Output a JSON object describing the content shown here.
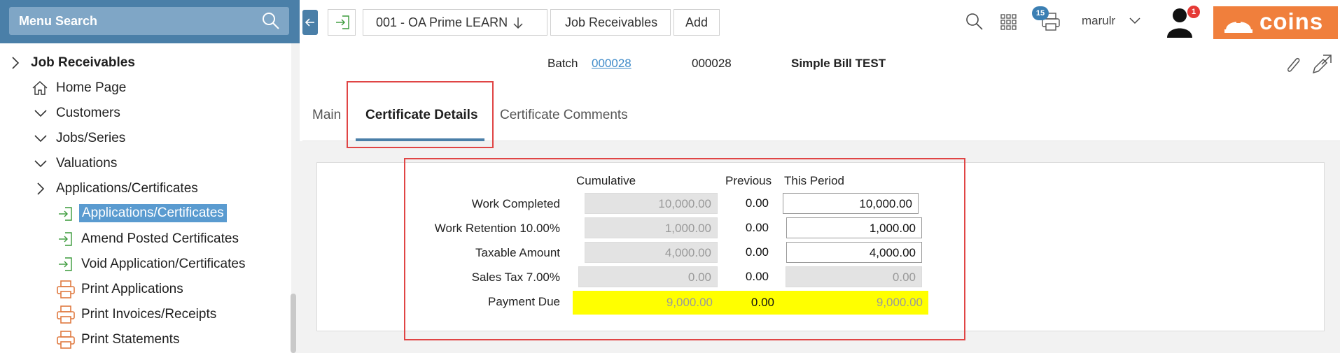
{
  "sidebar": {
    "search_label": "Menu Search",
    "items": [
      {
        "label": "Job Receivables",
        "icon": "chevron-right-icon"
      },
      {
        "label": "Home Page",
        "icon": "home-icon"
      },
      {
        "label": "Customers",
        "icon": "chevron-down-icon"
      },
      {
        "label": "Jobs/Series",
        "icon": "chevron-down-icon"
      },
      {
        "label": "Valuations",
        "icon": "chevron-down-icon"
      },
      {
        "label": "Applications/Certificates",
        "icon": "chevron-right-icon"
      },
      {
        "label": "Applications/Certificates",
        "icon": "enter-icon"
      },
      {
        "label": "Amend Posted Certificates",
        "icon": "enter-icon"
      },
      {
        "label": "Void Application/Certificates",
        "icon": "enter-icon"
      },
      {
        "label": "Print Applications",
        "icon": "printer-icon"
      },
      {
        "label": "Print Invoices/Receipts",
        "icon": "printer-icon"
      },
      {
        "label": "Print Statements",
        "icon": "printer-icon"
      }
    ]
  },
  "breadcrumbs": [
    "001 - OA Prime LEARN",
    "Job Receivables",
    "Add"
  ],
  "topbar": {
    "print_badge": "15",
    "user": "marulr",
    "notif_badge": "1",
    "brand": "coins"
  },
  "header": {
    "batch_label": "Batch",
    "batch_link": "000028",
    "batch_value": "000028",
    "batch_name": "Simple Bill TEST"
  },
  "tabs": [
    "Main",
    "Certificate Details",
    "Certificate Comments"
  ],
  "form": {
    "columns": [
      "Cumulative",
      "Previous",
      "This Period"
    ],
    "rows": [
      {
        "label": "Work Completed",
        "cumulative": "10,000.00",
        "previous": "0.00",
        "this_period": "10,000.00"
      },
      {
        "label": "Work Retention 10.00%",
        "cumulative": "1,000.00",
        "previous": "0.00",
        "this_period": "1,000.00"
      },
      {
        "label": "Taxable Amount",
        "cumulative": "4,000.00",
        "previous": "0.00",
        "this_period": "4,000.00"
      },
      {
        "label": "Sales Tax 7.00%",
        "cumulative": "0.00",
        "previous": "0.00",
        "this_period": "0.00"
      },
      {
        "label": "Payment Due",
        "cumulative": "9,000.00",
        "previous": "0.00",
        "this_period": "9,000.00"
      }
    ]
  },
  "colors": {
    "accent": "#4a7fa8",
    "brand": "#f07f3c",
    "highlight": "#ffff00",
    "annotation": "#e04545"
  }
}
